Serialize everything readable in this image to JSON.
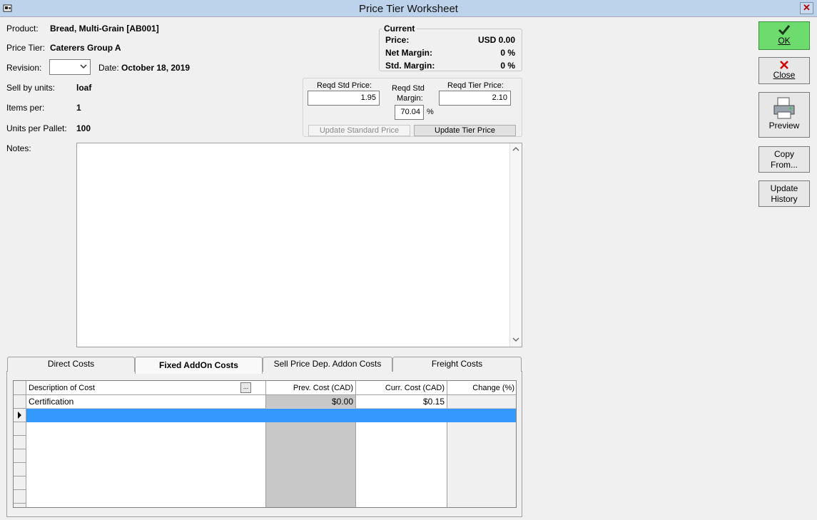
{
  "window": {
    "title": "Price Tier Worksheet"
  },
  "product": {
    "label": "Product:",
    "value": "Bread, Multi-Grain [AB001]"
  },
  "price_tier": {
    "label": "Price Tier:",
    "value": "Caterers Group A"
  },
  "revision": {
    "label": "Revision:",
    "value": ""
  },
  "date": {
    "label": "Date:",
    "value": "October 18, 2019"
  },
  "sell_by_units": {
    "label": "Sell by units:",
    "value": "loaf"
  },
  "items_per": {
    "label": "Items per:",
    "value": "1"
  },
  "units_per_pallet": {
    "label": "Units per Pallet:",
    "value": "100"
  },
  "notes": {
    "label": "Notes:",
    "value": ""
  },
  "current": {
    "legend": "Current",
    "price_label": "Price:",
    "price_value": "USD 0.00",
    "net_margin_label": "Net Margin:",
    "net_margin_value": "0 %",
    "std_margin_label": "Std. Margin:",
    "std_margin_value": "0 %"
  },
  "pricing": {
    "reqd_std_price_label": "Reqd Std Price:",
    "reqd_std_price_value": "1.95",
    "reqd_std_margin_label_1": "Reqd Std",
    "reqd_std_margin_label_2": "Margin:",
    "reqd_std_margin_value": "70.04",
    "percent_sign": "%",
    "reqd_tier_price_label": "Reqd Tier Price:",
    "reqd_tier_price_value": "2.10",
    "update_standard_label": "Update Standard Price",
    "update_tier_label": "Update Tier Price"
  },
  "tabs": [
    {
      "label": "Direct Costs",
      "active": false
    },
    {
      "label": "Fixed AddOn Costs",
      "active": true
    },
    {
      "label": "Sell Price Dep. Addon Costs",
      "active": false
    },
    {
      "label": "Freight Costs",
      "active": false
    }
  ],
  "grid": {
    "columns": [
      "Description of Cost",
      "Prev. Cost (CAD)",
      "Curr. Cost (CAD)",
      "Change (%)"
    ],
    "ellipsis": "...",
    "rows": [
      {
        "description": "Certification",
        "prev": "$0.00",
        "curr": "$0.15",
        "change": ""
      }
    ]
  },
  "buttons": {
    "ok": "OK",
    "close": "Close",
    "preview": "Preview",
    "copy_from_1": "Copy",
    "copy_from_2": "From...",
    "update_history_1": "Update",
    "update_history_2": "History"
  },
  "colors": {
    "title_bar": "#bdd3ec",
    "ok_green": "#6ddb6d",
    "selected_row": "#3399ff",
    "readonly_col": "#c8c8c8"
  }
}
